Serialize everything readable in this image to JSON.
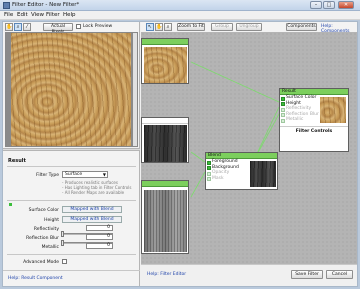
{
  "window": {
    "title": "Filter Editor - New Filter*",
    "minimize": "–",
    "maximize": "□",
    "close": "✕"
  },
  "menu": [
    "File",
    "Edit",
    "View",
    "Filter",
    "Help"
  ],
  "left_toolbar": {
    "actual_pixels": "Actual Pixels",
    "lock_preview": "Lock Preview"
  },
  "result_panel": {
    "heading": "Result",
    "filter_type_label": "Filter Type",
    "filter_type_value": "Surface",
    "notes": [
      "- Produces realistic surfaces",
      "- Has Lighting tab in Filter Controls",
      "- All Render Maps are available"
    ],
    "surface_color_label": "Surface Color",
    "surface_color_value": "Mapped with Blend",
    "height_label": "Height",
    "height_value": "Mapped with Blend",
    "reflectivity_label": "Reflectivity",
    "reflectivity_value": "0",
    "reflection_blur_label": "Reflection Blur",
    "reflection_blur_value": "0",
    "metallic_label": "Metallic",
    "metallic_value": "0",
    "advanced_mode_label": "Advanced Mode",
    "help_link": "Help: Result Component"
  },
  "right_toolbar": {
    "zoom_to_fit": "Zoom to Fit",
    "group": "Group",
    "ungroup": "Ungroup",
    "components": "Components",
    "help_components": "Help: Components"
  },
  "nodes": {
    "result": {
      "title": "Result",
      "ports": [
        "Surface Color",
        "Height",
        "Reflectivity",
        "Reflection Blur",
        "Metallic"
      ],
      "footer": "Filter Controls"
    },
    "blend": {
      "title": "Blend",
      "ports": [
        "Foreground",
        "Background",
        "Opacity",
        "Mask"
      ]
    }
  },
  "bottom_bar": {
    "help_link": "Help: Filter Editor",
    "save_filter": "Save Filter",
    "cancel": "Cancel"
  },
  "colors": {
    "accent_green": "#7ccf5d",
    "link_blue": "#1a3fa8",
    "canvas_grey": "#b4b4b4"
  }
}
